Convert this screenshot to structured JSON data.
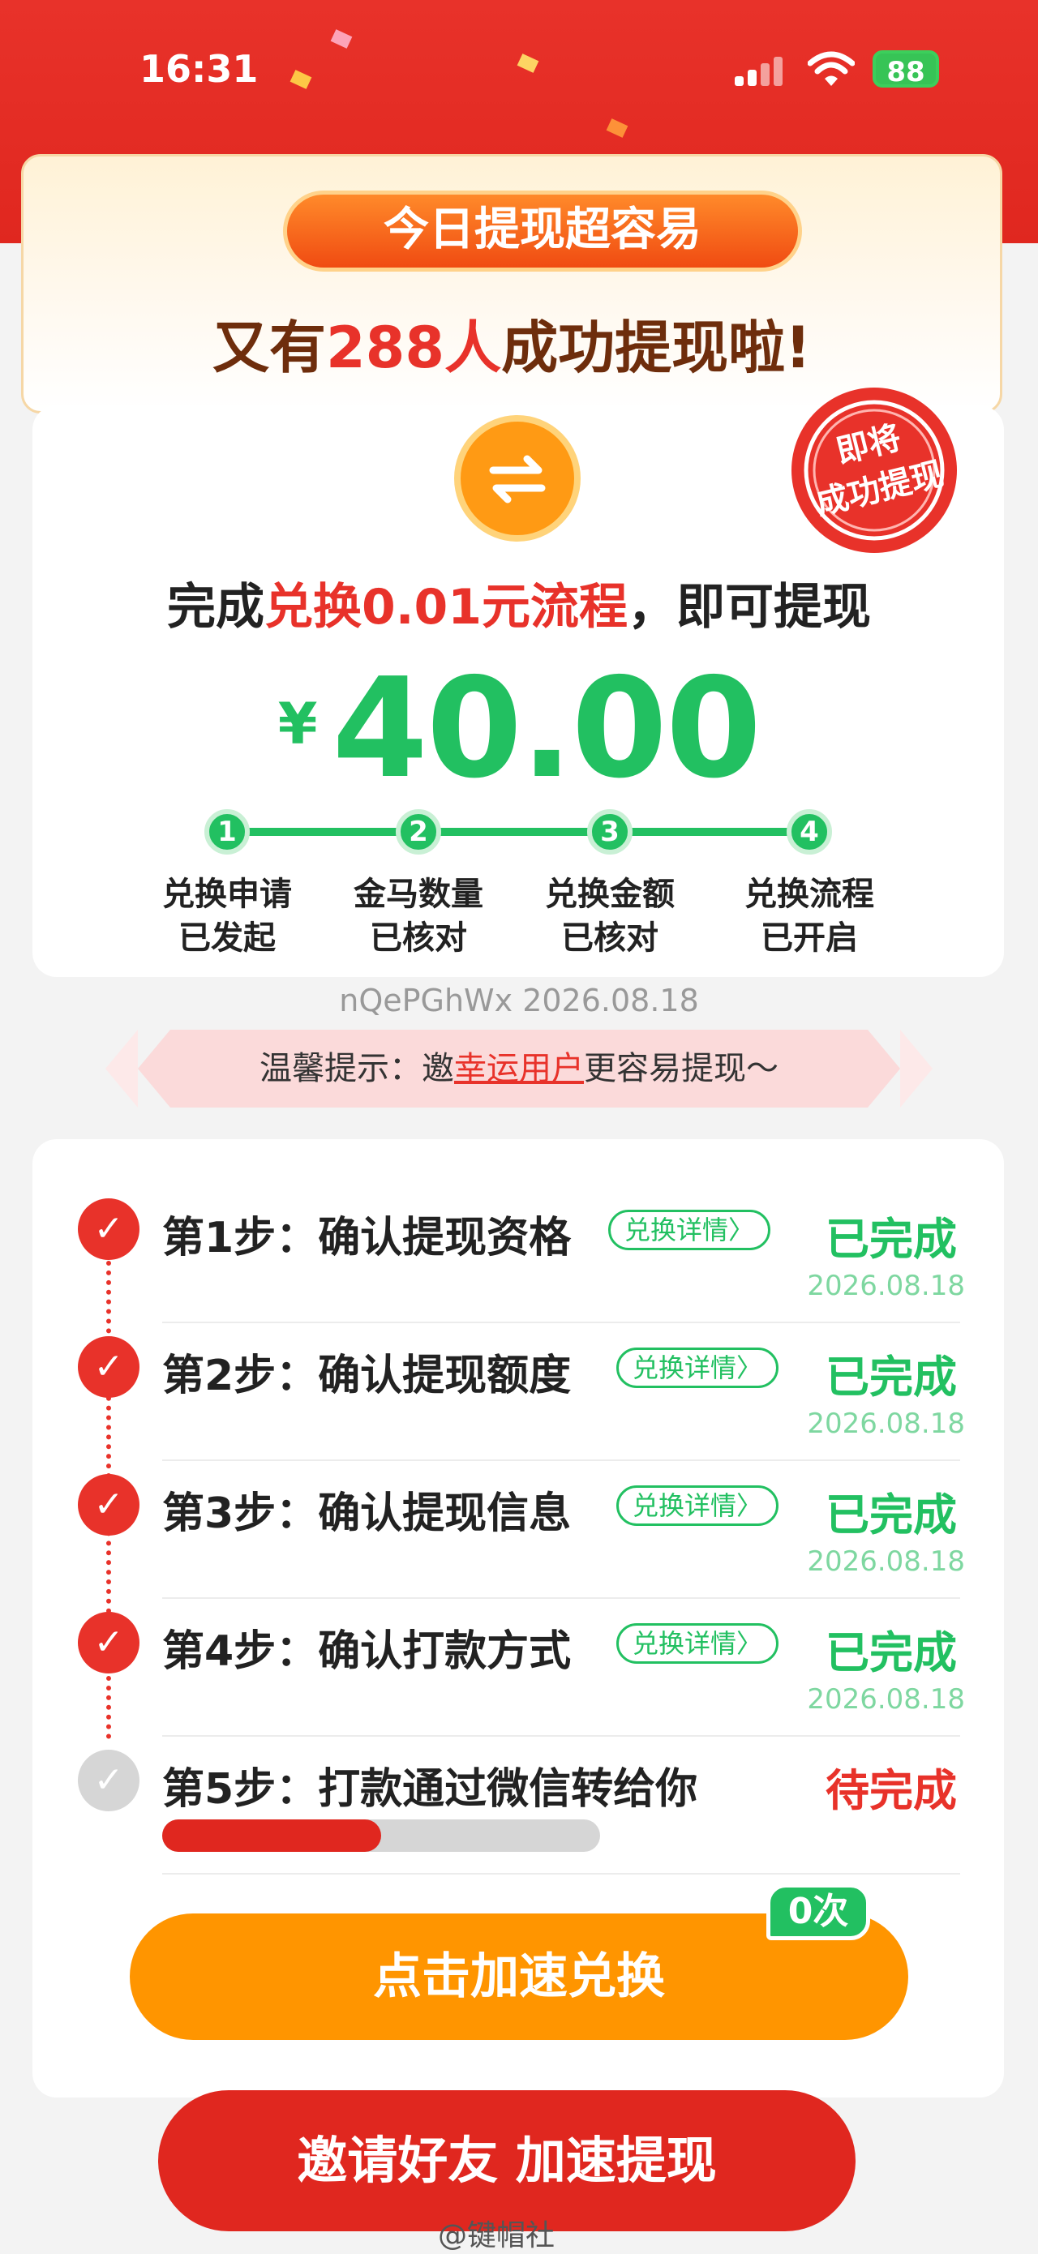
{
  "status_bar": {
    "time": "16:31",
    "battery": "88"
  },
  "banner": {
    "pill_title": "今日提现超容易",
    "sub_prefix": "又有",
    "sub_count": "288人",
    "sub_suffix": "成功提现啦!"
  },
  "seal": {
    "line1": "即将",
    "line2": "成功提现"
  },
  "headline": {
    "prefix": "完成",
    "highlight": "兑换0.01元流程",
    "suffix": "，即可提现"
  },
  "amount": {
    "currency": "¥",
    "value": "40.00"
  },
  "progress_steps": [
    {
      "num": "1",
      "line1": "兑换申请",
      "line2": "已发起"
    },
    {
      "num": "2",
      "line1": "金马数量",
      "line2": "已核对"
    },
    {
      "num": "3",
      "line1": "兑换金额",
      "line2": "已核对"
    },
    {
      "num": "4",
      "line1": "兑换流程",
      "line2": "已开启"
    }
  ],
  "code_line": "nQePGhWx 2026.08.18",
  "tip": {
    "prefix": "温馨提示：邀",
    "highlight": "幸运用户",
    "suffix": "更容易提现～"
  },
  "steps": [
    {
      "title": "第1步：确认提现资格",
      "detail": "兑换详情〉",
      "status": "已完成",
      "date": "2026.08.18"
    },
    {
      "title": "第2步：确认提现额度",
      "detail": "兑换详情〉",
      "status": "已完成",
      "date": "2026.08.18"
    },
    {
      "title": "第3步：确认提现信息",
      "detail": "兑换详情〉",
      "status": "已完成",
      "date": "2026.08.18"
    },
    {
      "title": "第4步：确认打款方式",
      "detail": "兑换详情〉",
      "status": "已完成",
      "date": "2026.08.18"
    },
    {
      "title": "第5步：打款通过微信转给你",
      "status": "待完成",
      "progress": 0.5
    }
  ],
  "cta": {
    "label": "点击加速兑换",
    "badge": "0次"
  },
  "invite": {
    "label": "邀请好友 加速提现"
  },
  "watermark": "@键帽社",
  "colors": {
    "red": "#e8322a",
    "green": "#22c061",
    "orange": "#ff9500"
  }
}
